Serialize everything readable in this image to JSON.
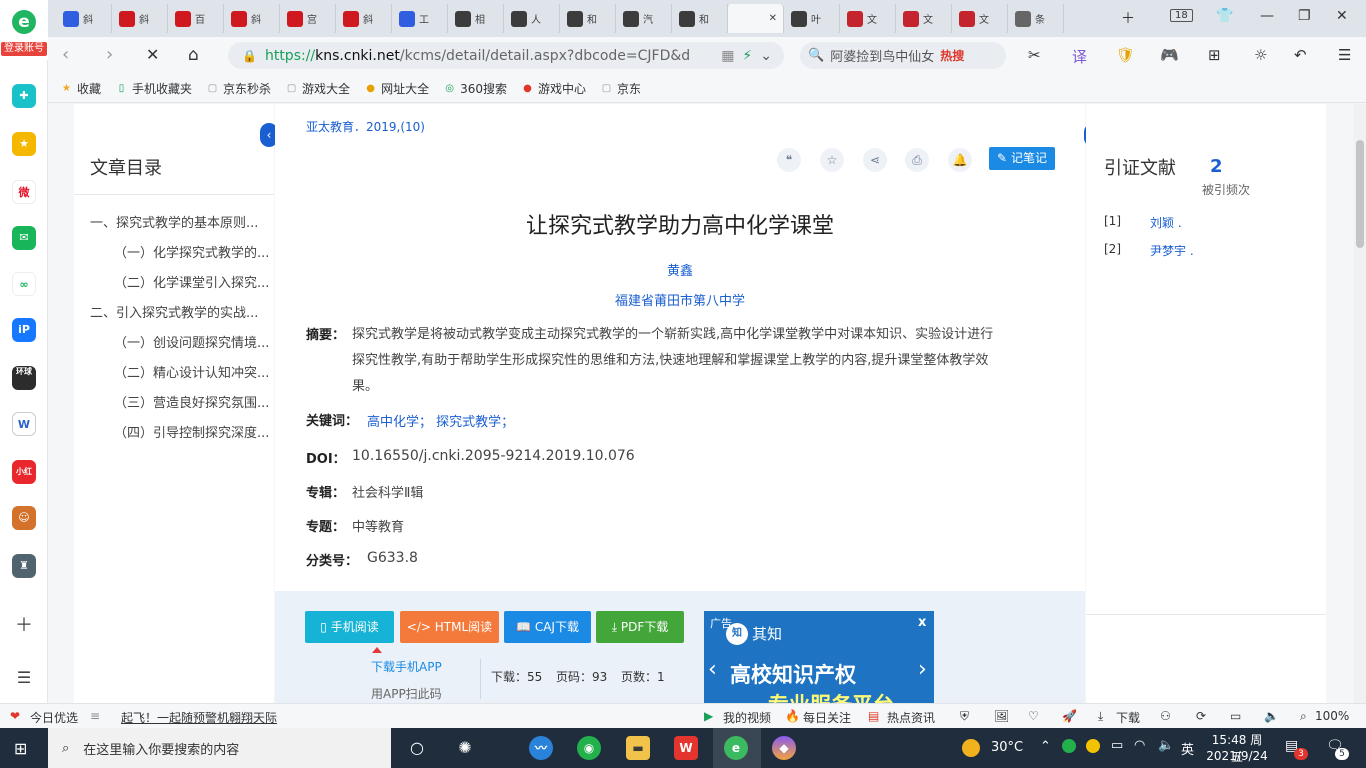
{
  "browser": {
    "logo_badge": "登录账号",
    "tabs": [
      {
        "icon": "baidu-paw-icon",
        "title": "斜",
        "color": "#2f5fe0"
      },
      {
        "icon": "yahoo-y-icon",
        "title": "斜",
        "color": "#d0181f"
      },
      {
        "icon": "yahoo-y-icon",
        "title": "百",
        "color": "#d0181f"
      },
      {
        "icon": "yahoo-y-icon",
        "title": "斜",
        "color": "#d0181f"
      },
      {
        "icon": "yahoo-y-icon",
        "title": "宫",
        "color": "#d0181f"
      },
      {
        "icon": "yahoo-y-icon",
        "title": "斜",
        "color": "#d0181f"
      },
      {
        "icon": "baidu-paw-icon",
        "title": "工",
        "color": "#2f5fe0"
      },
      {
        "icon": "cnki-zhi-icon",
        "title": "相",
        "color": "#3c3c3c"
      },
      {
        "icon": "cnki-zhi-icon",
        "title": "人",
        "color": "#3c3c3c"
      },
      {
        "icon": "cnki-zhi-icon",
        "title": "和",
        "color": "#3c3c3c"
      },
      {
        "icon": "cnki-zhi-icon",
        "title": "汽",
        "color": "#3c3c3c"
      },
      {
        "icon": "cnki-zhi-icon",
        "title": "和",
        "color": "#3c3c3c"
      },
      {
        "icon": "cnki-zhi-icon",
        "title": "叶",
        "color": "#3c3c3c"
      },
      {
        "icon": "long-icon",
        "title": "文",
        "color": "#c4242d"
      },
      {
        "icon": "long-icon",
        "title": "文",
        "color": "#c4242d"
      },
      {
        "icon": "long-icon",
        "title": "文",
        "color": "#c4242d"
      },
      {
        "icon": "reader-icon",
        "title": "条",
        "color": "#666666"
      }
    ],
    "tab_count": "18",
    "url_scheme": "https://",
    "url_host": "kns.cnki.net",
    "url_path": "/kcms/detail/detail.aspx?dbcode=CJFD&d",
    "search_text": "阿婆捡到鸟中仙女",
    "search_hot": "热搜"
  },
  "bookmarks": [
    {
      "label": "收藏",
      "icon": "star-icon"
    },
    {
      "label": "手机收藏夹",
      "icon": "phone-icon"
    },
    {
      "label": "京东秒杀",
      "icon": "page-icon"
    },
    {
      "label": "游戏大全",
      "icon": "page-icon"
    },
    {
      "label": "网址大全",
      "icon": "site-icon"
    },
    {
      "label": "360搜索",
      "icon": "search-360-icon"
    },
    {
      "label": "游戏中心",
      "icon": "game-icon"
    },
    {
      "label": "京东",
      "icon": "page-icon"
    }
  ],
  "toc": {
    "title": "文章目录",
    "items": [
      "一、探究式教学的基本原则...",
      "（一）化学探究式教学的...",
      "（二）化学课堂引入探究...",
      "二、引入探究式教学的实战...",
      "（一）创设问题探究情境...",
      "（二）精心设计认知冲突...",
      "（三）营造良好探究氛围...",
      "（四）引导控制探究深度..."
    ]
  },
  "article": {
    "source": "亚太教育．2019,(10)",
    "note_button": "记笔记",
    "title": "让探究式教学助力高中化学课堂",
    "author": "黄鑫",
    "institution": "福建省莆田市第八中学",
    "abstract_label": "摘要：",
    "abstract_lines": [
      "探究式教学是将被动式教学变成主动探究式教学的一个崭新实践,高中化学课堂教学中对课本知识、实验设计进行",
      "探究性教学,有助于帮助学生形成探究性的思维和方法,快速地理解和掌握课堂上教学的内容,提升课堂整体教学效",
      "果。"
    ],
    "keywords_label": "关键词：",
    "keywords": "高中化学；  探究式教学；",
    "doi_label": "DOI：",
    "doi": "10.16550/j.cnki.2095-9214.2019.10.076",
    "series_label": "专辑：",
    "series": "社会科学Ⅱ辑",
    "topic_label": "专题：",
    "topic": "中等教育",
    "class_label": "分类号：",
    "class": "G633.8"
  },
  "downloads": {
    "mobile": "手机阅读",
    "html": "HTML阅读",
    "caj": "CAJ下载",
    "pdf": "PDF下载",
    "app": "下载手机APP",
    "app_scan": "用APP扫此码",
    "download_count": "下载：55",
    "page_range": "页码：93",
    "page_count": "页数：1"
  },
  "ad": {
    "tag": "广告",
    "brand": "其知",
    "line1": "高校知识产权",
    "line2": "专业服务平台",
    "close": "x"
  },
  "citations": {
    "title": "引证文献",
    "count": "2",
    "count_label": "被引频次",
    "items": [
      {
        "num": "[1]",
        "author": "刘颖 ."
      },
      {
        "num": "[2]",
        "author": "尹梦宇 ."
      }
    ]
  },
  "statusbar": {
    "left1": "今日优选",
    "left2": "起飞！一起随预警机翱翔天际",
    "video": "我的视频",
    "daily": "每日关注",
    "news": "热点资讯",
    "download": "下载",
    "zoom": "100%"
  },
  "taskbar": {
    "search_placeholder": "在这里输入你要搜索的内容",
    "temperature": "30°C",
    "ime": "英",
    "time": "15:48 周五",
    "date": "2021/9/24",
    "notif_count": "3",
    "action_count": "5"
  }
}
